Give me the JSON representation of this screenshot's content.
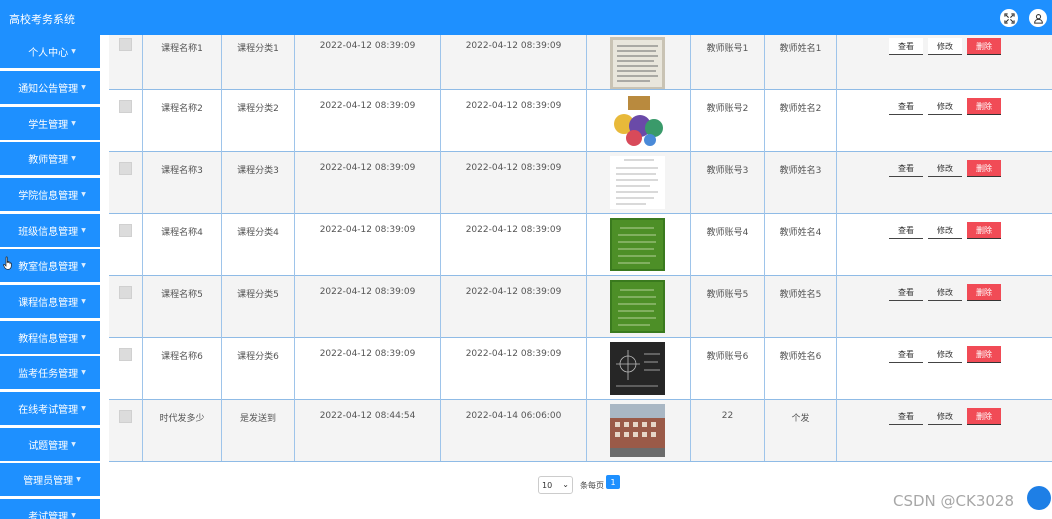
{
  "app": {
    "title": "高校考务系统"
  },
  "colors": {
    "primary": "#1e90ff",
    "danger": "#f14b56"
  },
  "header": {
    "icons": [
      "fullscreen-icon",
      "user-icon"
    ]
  },
  "sidebar": {
    "items": [
      {
        "label": "个人中心"
      },
      {
        "label": "通知公告管理"
      },
      {
        "label": "学生管理"
      },
      {
        "label": "教师管理"
      },
      {
        "label": "学院信息管理"
      },
      {
        "label": "班级信息管理"
      },
      {
        "label": "教室信息管理"
      },
      {
        "label": "课程信息管理"
      },
      {
        "label": "教程信息管理"
      },
      {
        "label": "监考任务管理"
      },
      {
        "label": "在线考试管理"
      },
      {
        "label": "试题管理"
      },
      {
        "label": "管理员管理"
      },
      {
        "label": "考试管理"
      }
    ]
  },
  "table": {
    "rows": [
      {
        "name": "课程名称1",
        "category": "课程分类1",
        "created": "2022-04-12 08:39:09",
        "updated": "2022-04-12 08:39:09",
        "account": "教师账号1",
        "teacher": "教师姓名1",
        "image": "document-photo"
      },
      {
        "name": "课程名称2",
        "category": "课程分类2",
        "created": "2022-04-12 08:39:09",
        "updated": "2022-04-12 08:39:09",
        "account": "教师账号2",
        "teacher": "教师姓名2",
        "image": "cartoon-illustration"
      },
      {
        "name": "课程名称3",
        "category": "课程分类3",
        "created": "2022-04-12 08:39:09",
        "updated": "2022-04-12 08:39:09",
        "account": "教师账号3",
        "teacher": "教师姓名3",
        "image": "form-document"
      },
      {
        "name": "课程名称4",
        "category": "课程分类4",
        "created": "2022-04-12 08:39:09",
        "updated": "2022-04-12 08:39:09",
        "account": "教师账号4",
        "teacher": "教师姓名4",
        "image": "green-chalkboard"
      },
      {
        "name": "课程名称5",
        "category": "课程分类5",
        "created": "2022-04-12 08:39:09",
        "updated": "2022-04-12 08:39:09",
        "account": "教师账号5",
        "teacher": "教师姓名5",
        "image": "green-chalkboard"
      },
      {
        "name": "课程名称6",
        "category": "课程分类6",
        "created": "2022-04-12 08:39:09",
        "updated": "2022-04-12 08:39:09",
        "account": "教师账号6",
        "teacher": "教师姓名6",
        "image": "black-chalkboard"
      },
      {
        "name": "时代发多少",
        "category": "是发送到",
        "created": "2022-04-12 08:44:54",
        "updated": "2022-04-14 06:06:00",
        "account": "22",
        "teacher": "个发",
        "image": "campus-photo"
      }
    ],
    "actions": {
      "view": "查看",
      "edit": "修改",
      "delete": "删除"
    }
  },
  "pagination": {
    "page_size": "10",
    "per_page_label": "条每页",
    "current_page": "1"
  },
  "watermark": "CSDN @CK3028"
}
